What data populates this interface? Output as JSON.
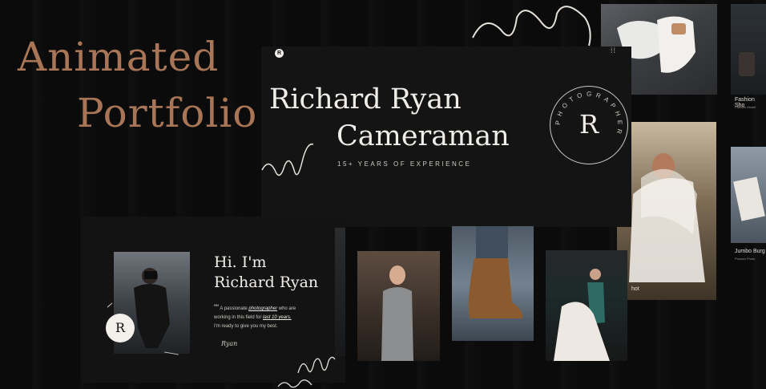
{
  "headline": {
    "line1": "Animated",
    "line2": "Portfolio"
  },
  "hero": {
    "logo_letter": "R",
    "name": "Richard Ryan",
    "role": "Cameraman",
    "experience": "15+ YEARS OF EXPERIENCE",
    "badge_letter": "R",
    "badge_ring_text": "PHOTOGRAPHER"
  },
  "about": {
    "greeting_line1": "Hi. I'm",
    "greeting_line2": "Richard Ryan",
    "quote_mark": "““",
    "bio_part1": "A passionate ",
    "bio_emph1": "photographer",
    "bio_part2": " who are",
    "bio_line2a": "working in this field for ",
    "bio_emph2": "last 10 years.",
    "bio_line3": "I'm ready to give you my best.",
    "signature": "Ryan",
    "badge_letter": "R"
  },
  "side_captions": [
    {
      "title": "Fashion Sho",
      "sub": "Fashion Model"
    },
    {
      "title": "Jumbo Burg",
      "sub": "Product Photo"
    }
  ],
  "partial_caption": "hot",
  "colors": {
    "accent": "#a87656",
    "panel": "#141414",
    "background": "#0b0b0b"
  },
  "icons": [
    "logo-icon",
    "grid-dots-icon",
    "quote-icon",
    "signature-icon",
    "squiggle-icon"
  ]
}
